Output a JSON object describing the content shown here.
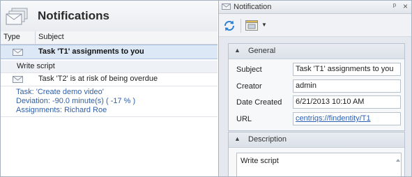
{
  "notifications": {
    "title": "Notifications",
    "columns": {
      "type": "Type",
      "subject": "Subject"
    },
    "rows": [
      {
        "subject": "Task 'T1' assignments to you",
        "selected": true
      },
      {
        "subject": "Write script"
      },
      {
        "subject": "Task 'T2' is at risk of being overdue"
      }
    ],
    "detail": {
      "task": "Task: 'Create demo video'",
      "deviation": "Deviation: -90.0 minute(s) ( -17 % )",
      "assignments": "Assignments: Richard Roe"
    }
  },
  "panel": {
    "title": "Notification",
    "pin_glyph": "ᵖ",
    "close_glyph": "×",
    "general": {
      "header": "General",
      "fields": [
        {
          "label": "Subject",
          "value": "Task 'T1' assignments to you"
        },
        {
          "label": "Creator",
          "value": "admin"
        },
        {
          "label": "Date Created",
          "value": "6/21/2013 10:10 AM"
        },
        {
          "label": "URL",
          "value": "centriqs://findentity/T1"
        }
      ]
    },
    "description": {
      "header": "Description",
      "text": "Write script"
    }
  },
  "colors": {
    "accent": "#2f5fa8",
    "selection": "#dde8f6",
    "panel_bg": "#e5e9ef"
  }
}
